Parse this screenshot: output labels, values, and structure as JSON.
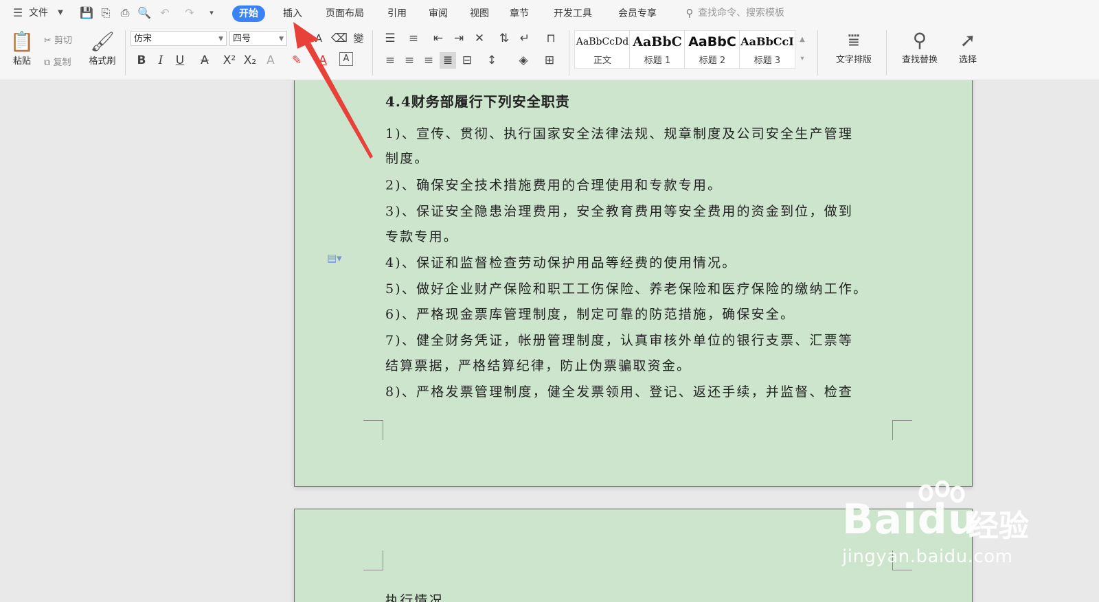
{
  "toolbar": {
    "menu_label": "文件",
    "tabs": [
      {
        "label": "开始",
        "active": true
      },
      {
        "label": "插入"
      },
      {
        "label": "页面布局"
      },
      {
        "label": "引用"
      },
      {
        "label": "审阅"
      },
      {
        "label": "视图"
      },
      {
        "label": "章节"
      },
      {
        "label": "开发工具"
      },
      {
        "label": "会员专享"
      }
    ],
    "search_placeholder": "查找命令、搜索模板",
    "active_tab_color": "#3b82f6"
  },
  "ribbon": {
    "paste_label": "粘贴",
    "cut_label": "剪切",
    "copy_label": "复制",
    "format_painter_label": "格式刷",
    "font_name": "仿宋",
    "font_size": "四号",
    "styles": [
      {
        "sample": "AaBbCcDd",
        "name": "正文"
      },
      {
        "sample": "AaBbC",
        "name": "标题 1"
      },
      {
        "sample": "AaBbC",
        "name": "标题 2"
      },
      {
        "sample": "AaBbCcI",
        "name": "标题 3"
      }
    ],
    "text_layout_label": "文字排版",
    "find_replace_label": "查找替换",
    "select_label": "选择"
  },
  "document": {
    "page_color": "#cce5cc",
    "heading": "4.4财务部履行下列安全职责",
    "lines": [
      "1)、宣传、贯彻、执行国家安全法律法规、规章制度及公司安全生产管理",
      "制度。",
      "2)、确保安全技术措施费用的合理使用和专款专用。",
      "3)、保证安全隐患治理费用，安全教育费用等安全费用的资金到位，做到",
      "专款专用。",
      "4)、保证和监督检查劳动保护用品等经费的使用情况。",
      "5)、做好企业财产保险和职工工伤保险、养老保险和医疗保险的缴纳工作。",
      "6)、严格现金票库管理制度，制定可靠的防范措施，确保安全。",
      "7)、健全财务凭证，帐册管理制度，认真审核外单位的银行支票、汇票等",
      "结算票据，严格结算纪律，防止伪票骗取资金。",
      "8)、严格发票管理制度，健全发票领用、登记、返还手续，并监督、检查"
    ],
    "page2_text": "执行情况"
  },
  "watermark": {
    "brand": "Bai",
    "brand2": "du",
    "tagline": "经验",
    "url": "jingyan.baidu.com"
  },
  "annotation_color": "#e8413a"
}
